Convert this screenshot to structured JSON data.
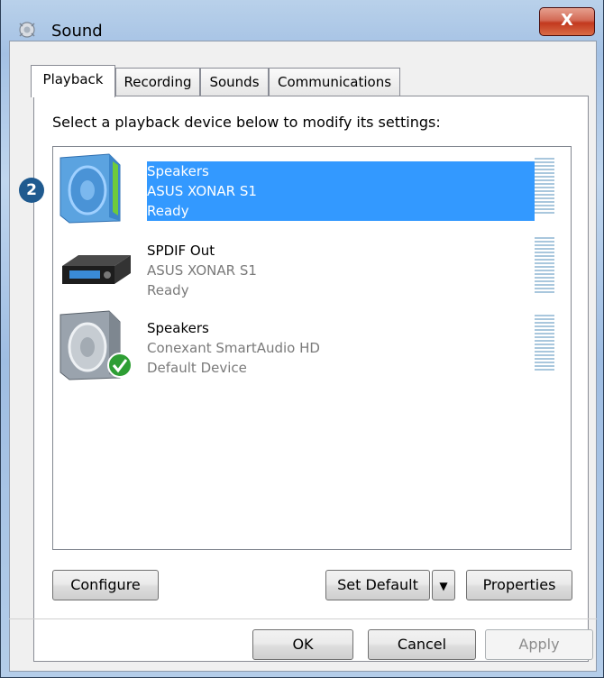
{
  "window": {
    "title": "Sound",
    "close_label": "X",
    "icon": "speaker-sound-icon"
  },
  "tabs": [
    {
      "label": "Playback",
      "active": true
    },
    {
      "label": "Recording",
      "active": false
    },
    {
      "label": "Sounds",
      "active": false
    },
    {
      "label": "Communications",
      "active": false
    }
  ],
  "instruction": "Select a playback device below to modify its settings:",
  "badge": "2",
  "devices": [
    {
      "name": "Speakers",
      "driver": "ASUS XONAR S1",
      "status": "Ready",
      "selected": true,
      "icon": "speaker-icon"
    },
    {
      "name": "SPDIF Out",
      "driver": "ASUS XONAR S1",
      "status": "Ready",
      "selected": false,
      "icon": "spdif-device-icon"
    },
    {
      "name": "Speakers",
      "driver": "Conexant SmartAudio HD",
      "status": "Default Device",
      "selected": false,
      "icon": "default-speaker-icon"
    }
  ],
  "buttons": {
    "configure": "Configure",
    "set_default": "Set Default",
    "properties": "Properties",
    "ok": "OK",
    "cancel": "Cancel",
    "apply": "Apply"
  },
  "colors": {
    "selection": "#3399ff",
    "close": "#c2381e",
    "badge": "#1f5a8f"
  }
}
